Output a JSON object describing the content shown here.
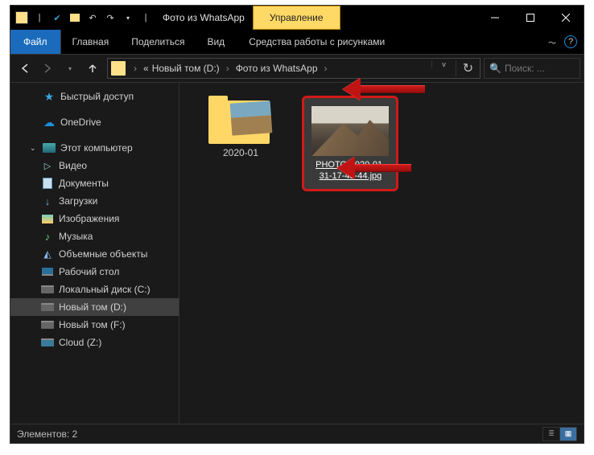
{
  "titlebar": {
    "title": "Фото из WhatsApp"
  },
  "ribbon": {
    "contextual_tab": "Управление",
    "contextual_group": "Средства работы с рисунками"
  },
  "tabs": {
    "file": "Файл",
    "home": "Главная",
    "share": "Поделиться",
    "view": "Вид"
  },
  "breadcrumb": {
    "seg1": "«",
    "seg2": "Новый том (D:)",
    "seg3": "Фото из WhatsApp"
  },
  "search": {
    "placeholder": "Поиск: ..."
  },
  "sidebar": {
    "quick": "Быстрый доступ",
    "onedrive": "OneDrive",
    "pc": "Этот компьютер",
    "videos": "Видео",
    "documents": "Документы",
    "downloads": "Загрузки",
    "pictures": "Изображения",
    "music": "Музыка",
    "objects3d": "Объемные объекты",
    "desktop": "Рабочий стол",
    "drive_c": "Локальный диск (C:)",
    "drive_d": "Новый том (D:)",
    "drive_f": "Новый том (F:)",
    "drive_z": "Cloud (Z:)"
  },
  "content": {
    "folder_name": "2020-01",
    "selected_file": "PHOTO-2020-01-31-17-48-44.jpg"
  },
  "status": {
    "items": "Элементов: 2"
  }
}
